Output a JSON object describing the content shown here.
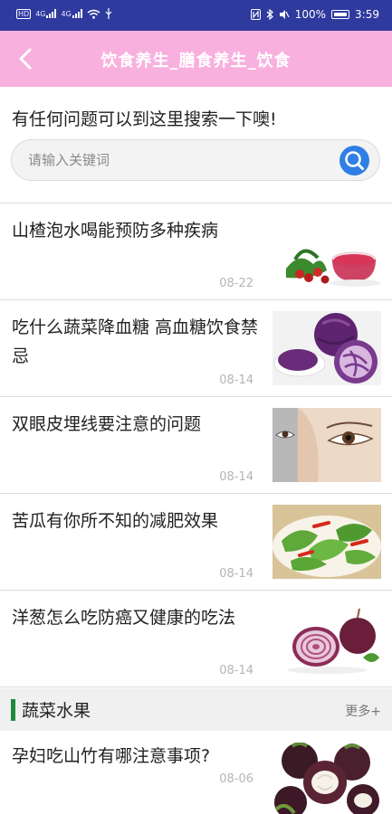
{
  "status_bar": {
    "left_icons": [
      "HD-icon",
      "4G-signal-icon",
      "4G-signal-icon",
      "wifi-icon",
      "usb-icon"
    ],
    "hd_label": "HD",
    "net1": "4G",
    "net2": "4G",
    "right_icons": [
      "nfc-icon",
      "bluetooth-icon",
      "mute-icon",
      "battery-icon"
    ],
    "battery": "100%",
    "time": "3:59"
  },
  "header": {
    "title": "饮食养生_膳食养生_饮食",
    "accent": "#f8b0df"
  },
  "search": {
    "prompt": "有任何问题可以到这里搜索一下噢!",
    "placeholder": "请输入关键词",
    "value": ""
  },
  "articles": [
    {
      "title": "山楂泡水喝能预防多种疾病",
      "date": "08-22",
      "thumb": "hawthorn-tea-image"
    },
    {
      "title": "吃什么蔬菜降血糖 高血糖饮食禁忌",
      "date": "08-14",
      "thumb": "purple-cabbage-image"
    },
    {
      "title": "双眼皮埋线要注意的问题",
      "date": "08-14",
      "thumb": "eye-closeup-image"
    },
    {
      "title": "苦瓜有你所不知的减肥效果",
      "date": "08-14",
      "thumb": "bitter-melon-dish-image"
    },
    {
      "title": "洋葱怎么吃防癌又健康的吃法",
      "date": "08-14",
      "thumb": "red-onion-image"
    }
  ],
  "section": {
    "title": "蔬菜水果",
    "more": "更多+",
    "bar_color": "#1e8a3c"
  },
  "section_articles": [
    {
      "title": "孕妇吃山竹有哪注意事项?",
      "date": "08-06",
      "thumb": "mangosteen-image"
    }
  ]
}
